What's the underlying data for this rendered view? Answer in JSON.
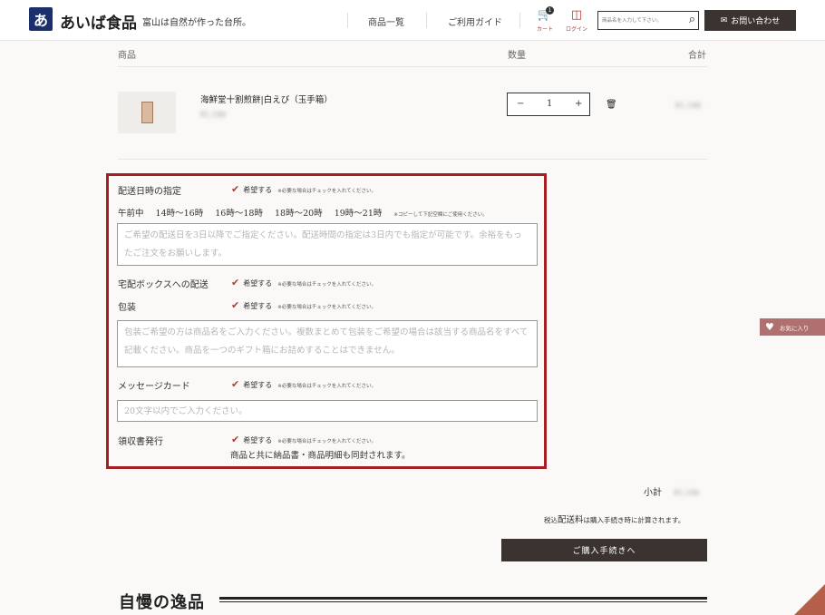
{
  "header": {
    "logo_mark": "あ",
    "logo_text": "あいば食品",
    "tagline": "富山は自然が作った台所。",
    "nav": [
      "商品一覧",
      "ご利用ガイド"
    ],
    "cart_label": "カート",
    "cart_count": "1",
    "login_label": "ログイン",
    "search_placeholder": "商品名を入力して下さい。",
    "contact_label": "お問い合わせ"
  },
  "cart_table": {
    "col_product": "商品",
    "col_qty": "数量",
    "col_total": "合計",
    "item": {
      "name": "海鮮堂十割煎餅|白えび（玉手箱）",
      "price": "¥1,188",
      "qty": "1",
      "line_total": "¥1,188"
    },
    "qty_minus": "−",
    "qty_plus": "+"
  },
  "options": {
    "check_label": "希望する",
    "check_note": "※必要な場合はチェックを入れてください。",
    "delivery_date": {
      "label": "配送日時の指定",
      "slots": [
        "午前中",
        "14時〜16時",
        "16時〜18時",
        "18時〜20時",
        "19時〜21時"
      ],
      "slots_note": "※コピーして下記空欄にご使用ください。",
      "placeholder": "ご希望の配送日を3日以降でご指定ください。配送時間の指定は3日内でも指定が可能です。余裕をもったご注文をお願いします。"
    },
    "delivery_box": {
      "label": "宅配ボックスへの配送"
    },
    "wrapping": {
      "label": "包装",
      "placeholder": "包装ご希望の方は商品名をご入力ください。複数まとめて包装をご希望の場合は該当する商品名をすべて記載ください。商品を一つのギフト箱にお詰めすることはできません。"
    },
    "message_card": {
      "label": "メッセージカード",
      "placeholder": "20文字以内でご入力ください。"
    },
    "receipt": {
      "label": "領収書発行",
      "info": "商品と共に納品書・商品明細も同封されます。"
    }
  },
  "summary": {
    "subtotal_label": "小計",
    "subtotal_value": "¥1,188",
    "tax_prefix": "税込",
    "shipping_word": "配送料",
    "shipping_rest": "は購入手続き時に計算されます。",
    "checkout_label": "ご購入手続きへ"
  },
  "favorites_tab": "お気に入り",
  "section_title": "自慢の逸品",
  "colors": {
    "accent_red": "#a71e24",
    "dark_button": "#3a3330",
    "brand_navy": "#1a2f6b"
  }
}
